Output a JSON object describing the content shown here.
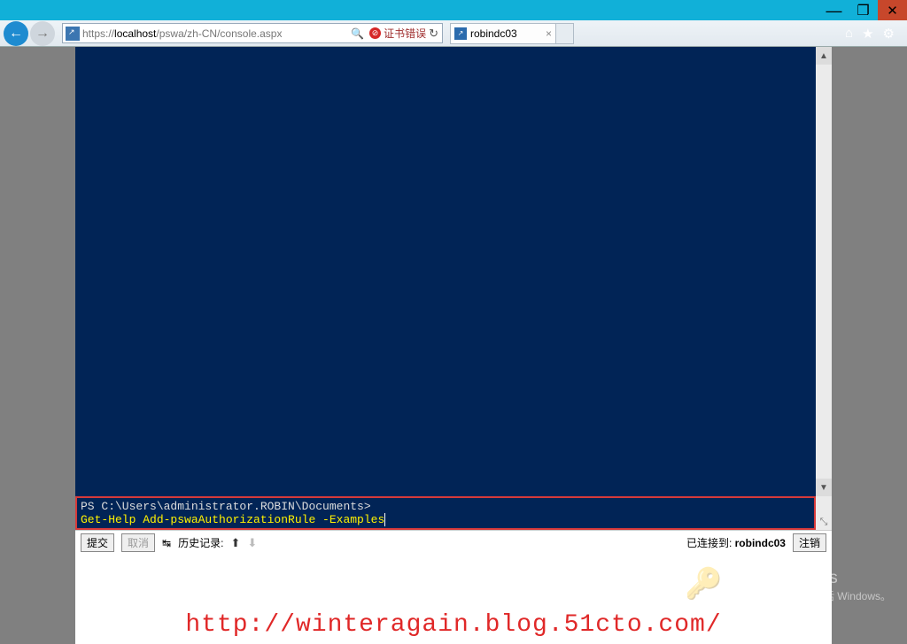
{
  "titlebar": {
    "min": "—",
    "max": "❐",
    "close": "✕"
  },
  "ie": {
    "back": "←",
    "fwd": "→",
    "url_prefix": "https://",
    "url_host": "localhost",
    "url_path": "/pswa/zh-CN/console.aspx",
    "cert_error": "证书错误",
    "refresh": "↻",
    "search": "🔍",
    "tab_title": "robindc03",
    "tab_close": "×",
    "icon_home": "⌂",
    "icon_fav": "★",
    "icon_gear": "⚙"
  },
  "console": {
    "scroll_up": "▲",
    "scroll_down": "▼",
    "prompt": "PS C:\\Users\\administrator.ROBIN\\Documents>",
    "command": "Get-Help Add-pswaAuthorizationRule -Examples",
    "resize": "⤡"
  },
  "toolbar": {
    "submit": "提交",
    "cancel": "取消",
    "tab_icon": "↹",
    "history_label": "历史记录:",
    "up": "⬆",
    "down": "⬇",
    "connected_label": "已连接到:",
    "connected_host": "robindc03",
    "logout": "注销"
  },
  "watermark": {
    "key": "🔑",
    "line1": "激活 Windows",
    "line2": "转到\"操作中心\"以激活 Windows。"
  },
  "overlay": {
    "blog": "http://winteragain.blog.51cto.com/"
  }
}
